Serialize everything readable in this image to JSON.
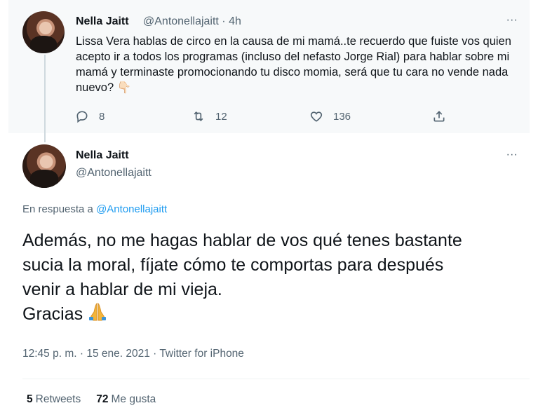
{
  "parent_tweet": {
    "display_name": "Nella Jaitt",
    "handle_time": "@Antonellajaitt · 4h",
    "text": "Lissa Vera hablas de circo en la causa de mi mamá..te recuerdo que fuiste vos quien acepto ir a todos los programas (incluso del nefasto Jorge Rial) para hablar sobre mi mamá y terminaste promocionando tu disco momia, será que tu cara no vende nada nuevo? 👇🏻",
    "actions": {
      "replies": "8",
      "retweets": "12",
      "likes": "136"
    },
    "more_icon": "more-dots-icon"
  },
  "main_tweet": {
    "display_name": "Nella Jaitt",
    "handle": "@Antonellajaitt",
    "reply_prefix": "En respuesta a",
    "reply_mention": "@Antonellajaitt",
    "text_lines": [
      "Además, no me hagas hablar de vos qué tenes bastante",
      "sucia la moral, fíjate cómo te comportas para después",
      "venir a hablar de mi vieja.",
      "Gracias"
    ],
    "emoji": "🙏",
    "timestamp": "12:45 p. m. · 15 ene. 2021 · Twitter for iPhone",
    "retweets_count": "5",
    "retweets_label": "Retweets",
    "likes_count": "72",
    "likes_label": "Me gusta"
  },
  "colors": {
    "accent": "#1d9bf0",
    "muted": "#536471",
    "parent_bg": "#f7f9fa",
    "emoji_fill": "#f4b53a"
  }
}
